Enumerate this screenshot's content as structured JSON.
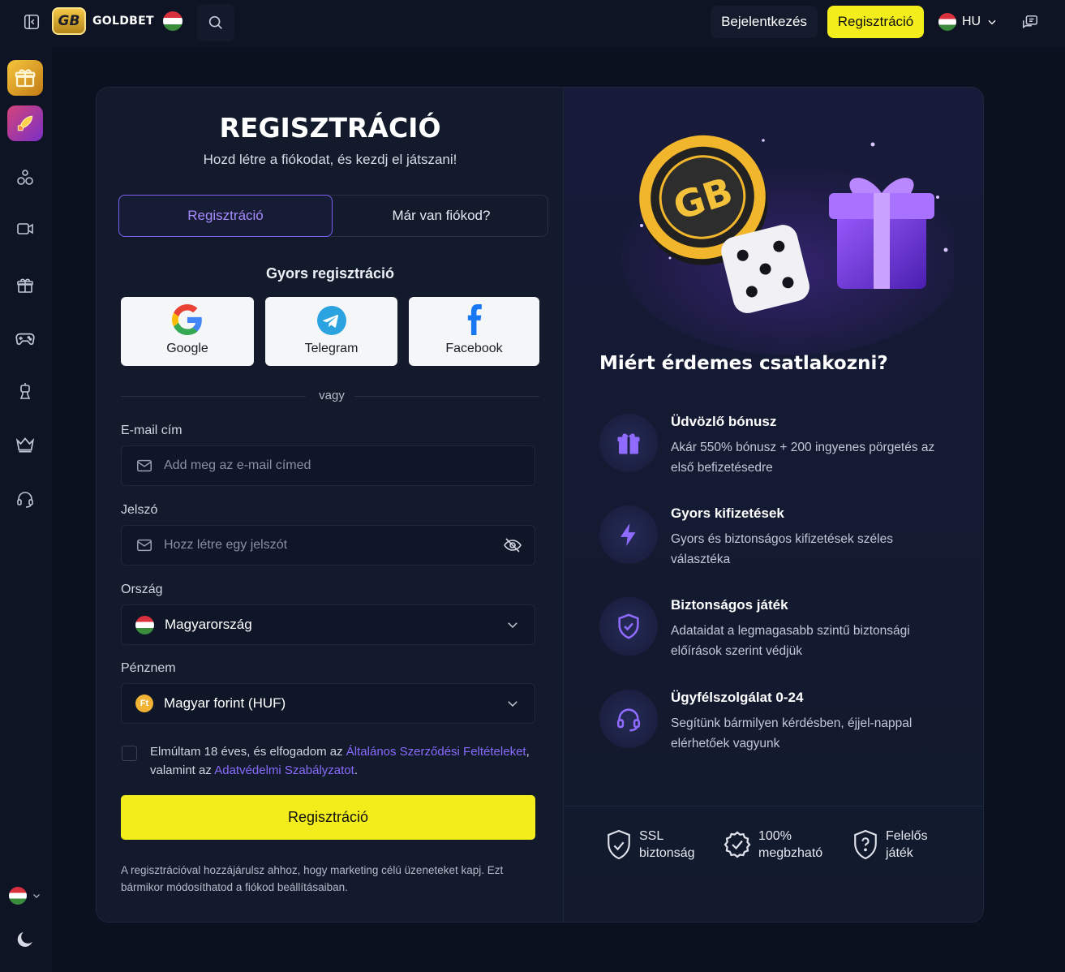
{
  "brand": {
    "logo_mark": "GB",
    "name": "GOLDBET"
  },
  "header": {
    "login_label": "Bejelentkezés",
    "register_label": "Regisztráció",
    "language": "HU"
  },
  "form": {
    "title": "REGISZTRÁCIÓ",
    "subtitle": "Hozd létre a fiókodat, és kezdj el játszani!",
    "tabs": [
      {
        "label": "Regisztráció",
        "active": true
      },
      {
        "label": "Már van fiókod?",
        "active": false
      }
    ],
    "quick_heading": "Gyors regisztráció",
    "social": [
      {
        "label": "Google",
        "icon": "google-icon"
      },
      {
        "label": "Telegram",
        "icon": "telegram-icon"
      },
      {
        "label": "Facebook",
        "icon": "facebook-icon"
      }
    ],
    "or_text": "vagy",
    "email": {
      "label": "E-mail cím",
      "placeholder": "Add meg az e-mail címed",
      "value": ""
    },
    "password": {
      "label": "Jelszó",
      "placeholder": "Hozz létre egy jelszót",
      "value": ""
    },
    "country": {
      "label": "Ország",
      "value": "Magyarország"
    },
    "currency": {
      "label": "Pénznem",
      "value": "Magyar forint (HUF)",
      "badge": "Ft"
    },
    "terms": {
      "part1": "Elmúltam 18 éves, és elfogadom az ",
      "link1": "Általános Szerződési Feltételeket",
      "part2": ", valamint az ",
      "link2": "Adatvédelmi Szabályzatot",
      "part3": ".",
      "checked": false
    },
    "submit_label": "Regisztráció",
    "note": "A regisztrációval hozzájárulsz ahhoz, hogy marketing célú üzeneteket kapj. Ezt bármikor módosíthatod a fiókod beállításaiban."
  },
  "benefits": {
    "heading": "Miért érdemes csatlakozni?",
    "items": [
      {
        "title": "Üdvözlő bónusz",
        "desc": "Akár 550% bónusz + 200 ingyenes pörgetés az első befizetésedre",
        "icon": "gift-icon"
      },
      {
        "title": "Gyors kifizetések",
        "desc": "Gyors és biztonságos kifizetések széles választéka",
        "icon": "lightning-icon"
      },
      {
        "title": "Biztonságos játék",
        "desc": "Adataidat a legmagasabb szintű biztonsági előírások szerint védjük",
        "icon": "shield-icon"
      },
      {
        "title": "Ügyfélszolgálat 0-24",
        "desc": "Segítünk bármilyen kérdésben, éjjel-nappal elérhetőek vagyunk",
        "icon": "headset-icon"
      }
    ]
  },
  "trust": [
    {
      "line1": "SSL",
      "line2": "biztonság"
    },
    {
      "line1": "100%",
      "line2": "megbzható"
    },
    {
      "line1": "Felelős",
      "line2": "játék"
    }
  ],
  "colors": {
    "accent_yellow": "#f4ed1c",
    "accent_purple": "#8a6bff",
    "background": "#0c1120"
  }
}
